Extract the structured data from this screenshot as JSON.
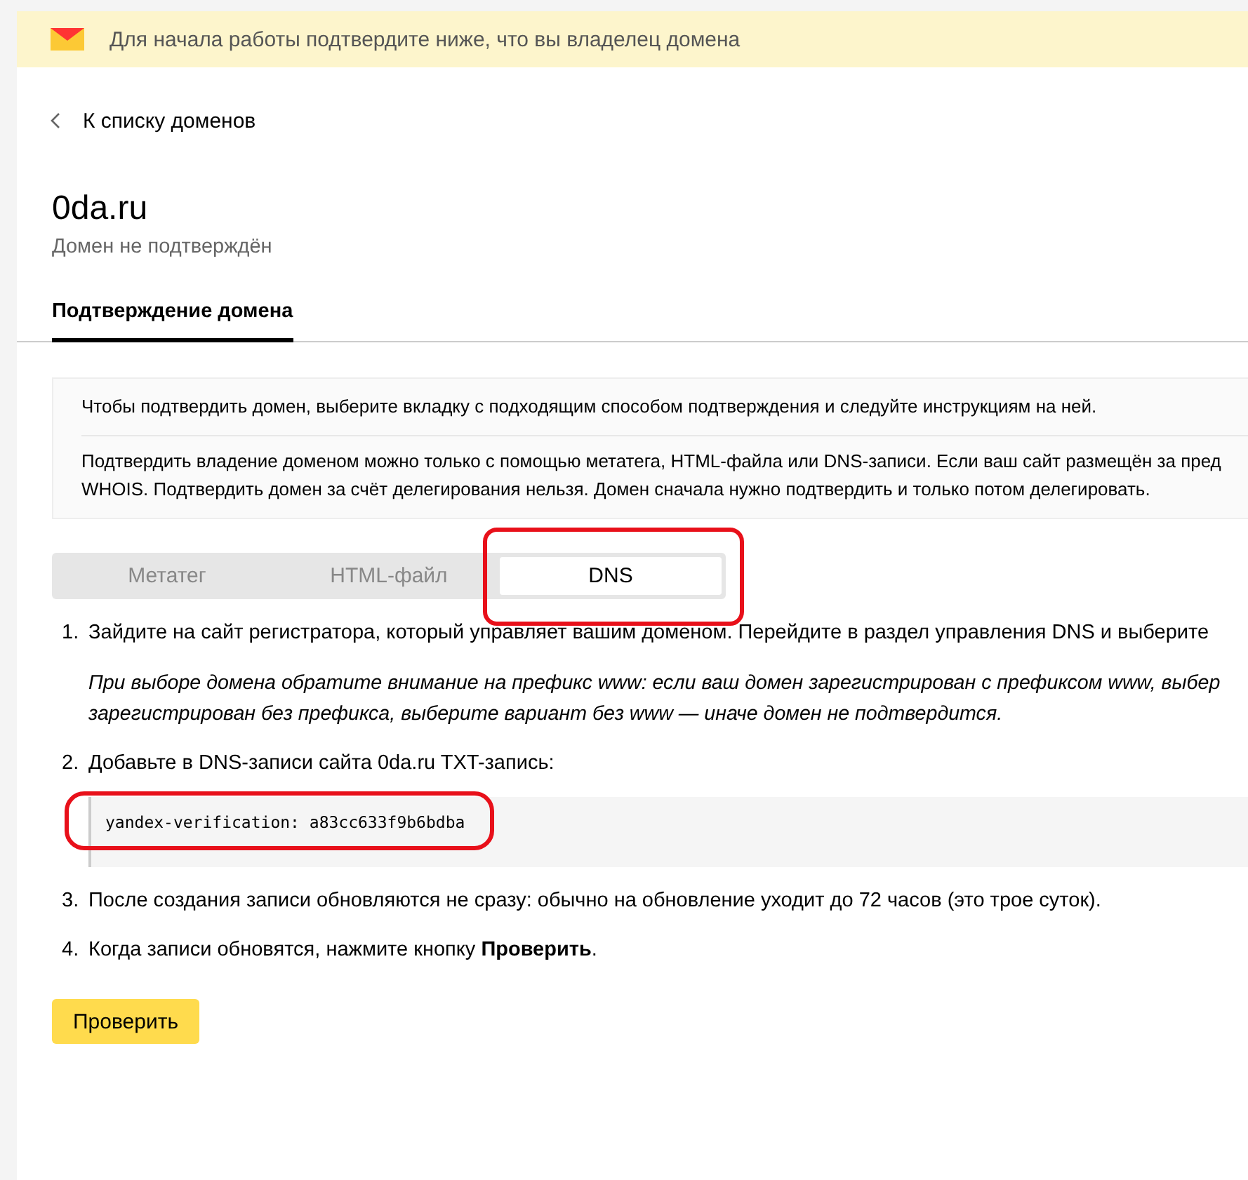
{
  "banner": {
    "text": "Для начала работы подтвердите ниже, что вы владелец домена"
  },
  "back_link": {
    "label": "К списку доменов"
  },
  "domain": {
    "name": "0da.ru",
    "status": "Домен не подтверждён"
  },
  "page_tabs": [
    {
      "label": "Подтверждение домена",
      "selected": true
    }
  ],
  "info": {
    "paragraphs": [
      [
        "Чтобы подтвердить домен, выберите вкладку с подходящим способом подтверждения и следуйте инструкциям на ней."
      ],
      [
        "Подтвердить владение доменом можно только с помощью метатега, HTML-файла или DNS-записи. Если ваш сайт размещён за пред",
        "WHOIS. Подтвердить домен за счёт делегирования нельзя. Домен сначала нужно подтвердить и только потом делегировать."
      ]
    ]
  },
  "method_tabs": {
    "highlighted": true,
    "items": [
      {
        "label": "Метатег",
        "selected": false
      },
      {
        "label": "HTML-файл",
        "selected": false
      },
      {
        "label": "DNS",
        "selected": true
      }
    ]
  },
  "steps": [
    {
      "number": "1.",
      "text": "Зайдите на сайт регистратора, который управляет вашим доменом. Перейдите в раздел управления DNS и выберите",
      "note_lines": [
        "При выборе домена обратите внимание на префикс www: если ваш домен зарегистрирован с префиксом www, выбер",
        "зарегистрирован без префикса, выберите вариант без www — иначе домен не подтвердится."
      ]
    },
    {
      "number": "2.",
      "text": "Добавьте в DNS-записи сайта 0da.ru TXT-запись:",
      "record": {
        "text": "yandex-verification: a83cc633f9b6bdba",
        "highlighted": true
      }
    },
    {
      "number": "3.",
      "text": "После создания записи обновляются не сразу: обычно на обновление уходит до 72 часов (это трое суток)."
    },
    {
      "number": "4.",
      "text": "Когда записи обновятся, нажмите кнопку **Проверить**."
    }
  ],
  "check_button": {
    "label": "Проверить"
  }
}
